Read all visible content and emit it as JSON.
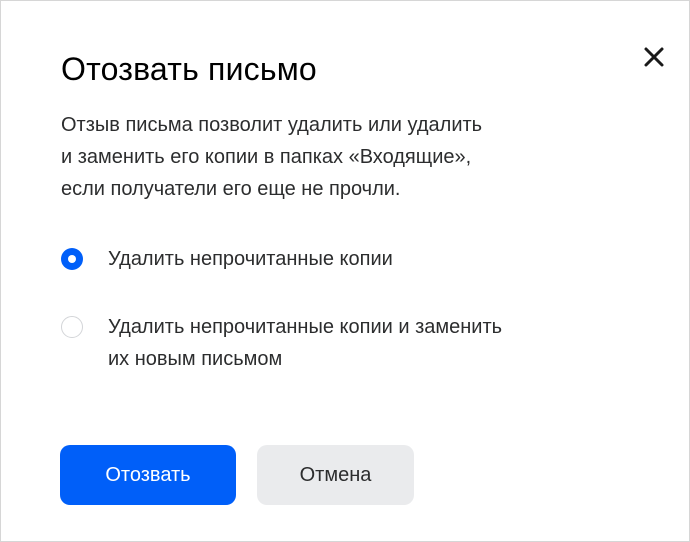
{
  "dialog": {
    "title": "Отозвать письмо",
    "description_lines": [
      "Отзыв письма позволит удалить или удалить",
      "и заменить его копии в папках «Входящие»,",
      "если получатели его еще не прочли."
    ],
    "options": [
      {
        "label_lines": [
          "Удалить непрочитанные копии"
        ],
        "checked": true
      },
      {
        "label_lines": [
          "Удалить непрочитанные копии и заменить",
          "их новым письмом"
        ],
        "checked": false
      }
    ],
    "primary_button": "Отозвать",
    "secondary_button": "Отмена"
  },
  "colors": {
    "accent": "#005ff9",
    "secondary_button_bg": "#eaebed",
    "text": "#2c2d2e"
  },
  "icons": {
    "close": "close-icon"
  }
}
